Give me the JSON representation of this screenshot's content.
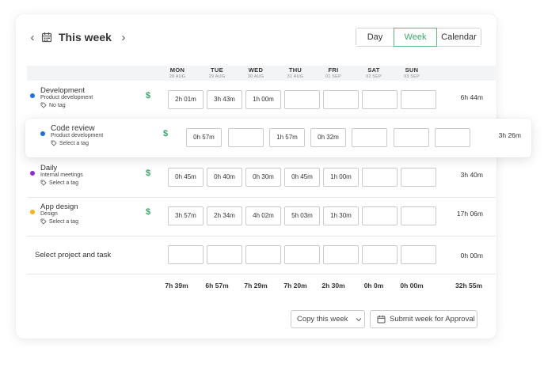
{
  "header": {
    "prev_icon": "chevron-left-icon",
    "calendar_icon": "calendar-icon",
    "title": "This week",
    "next_icon": "chevron-right-icon"
  },
  "views": {
    "day": "Day",
    "week": "Week",
    "calendar": "Calendar",
    "active": "Week"
  },
  "days": [
    {
      "name": "MON",
      "date": "28 AUG"
    },
    {
      "name": "TUE",
      "date": "29 AUG"
    },
    {
      "name": "WED",
      "date": "30 AUG"
    },
    {
      "name": "THU",
      "date": "31 AUG"
    },
    {
      "name": "FRI",
      "date": "01 SEP"
    },
    {
      "name": "SAT",
      "date": "02 SEP"
    },
    {
      "name": "SUN",
      "date": "03 SEP"
    }
  ],
  "rows": [
    {
      "name": "Development",
      "project": "Product development",
      "tag": "No tag",
      "color": "#1f6fe0",
      "billable": "$",
      "cells": [
        "2h 01m",
        "3h 43m",
        "1h 00m",
        "",
        "",
        "",
        ""
      ],
      "total": "6h 44m"
    },
    {
      "name": "Code review",
      "project": "Product development",
      "tag": "Select a tag",
      "color": "#1f6fe0",
      "billable": "$",
      "cells": [
        "0h 57m",
        "",
        "1h 57m",
        "0h 32m",
        "",
        "",
        ""
      ],
      "total": "3h 26m"
    },
    {
      "name": "Daily",
      "project": "Internal meetings",
      "tag": "Select a tag",
      "color": "#8e2bd6",
      "billable": "$",
      "cells": [
        "0h 45m",
        "0h 40m",
        "0h 30m",
        "0h 45m",
        "1h 00m",
        "",
        ""
      ],
      "total": "3h 40m"
    },
    {
      "name": "App design",
      "project": "Design",
      "tag": "Select a tag",
      "color": "#f2b416",
      "billable": "$",
      "cells": [
        "3h 57m",
        "2h 34m",
        "4h 02m",
        "5h 03m",
        "1h 30m",
        "",
        ""
      ],
      "total": "17h 06m"
    }
  ],
  "new_row": {
    "label": "Select project and task",
    "cells": [
      "",
      "",
      "",
      "",
      "",
      "",
      ""
    ],
    "total": "0h 00m"
  },
  "totals": {
    "days": [
      "7h 39m",
      "6h 57m",
      "7h 29m",
      "7h 20m",
      "2h 30m",
      "0h 0m",
      "0h 00m"
    ],
    "week": "32h 55m"
  },
  "actions": {
    "copy": "Copy this week",
    "submit": "Submit week for Approval"
  },
  "colors": {
    "accent": "#3ca768",
    "billable": "#3aa46a"
  }
}
